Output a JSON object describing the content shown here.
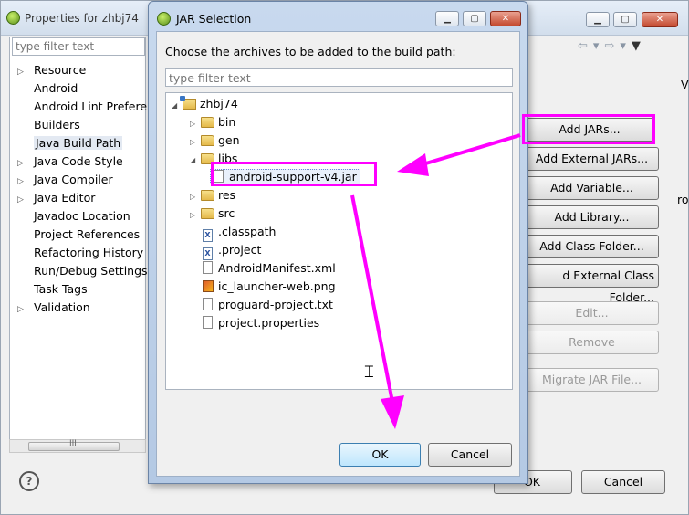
{
  "background_window": {
    "title": "Properties for zhbj74",
    "filter_placeholder": "type filter text",
    "tree_items": [
      {
        "label": "Resource",
        "expandable": true
      },
      {
        "label": "Android",
        "expandable": false
      },
      {
        "label": "Android Lint Preferences",
        "expandable": false
      },
      {
        "label": "Builders",
        "expandable": false
      },
      {
        "label": "Java Build Path",
        "expandable": false,
        "selected": true
      },
      {
        "label": "Java Code Style",
        "expandable": true
      },
      {
        "label": "Java Compiler",
        "expandable": true
      },
      {
        "label": "Java Editor",
        "expandable": true
      },
      {
        "label": "Javadoc Location",
        "expandable": false
      },
      {
        "label": "Project References",
        "expandable": false
      },
      {
        "label": "Refactoring History",
        "expandable": false
      },
      {
        "label": "Run/Debug Settings",
        "expandable": false
      },
      {
        "label": "Task Tags",
        "expandable": false
      },
      {
        "label": "Validation",
        "expandable": true
      }
    ],
    "buttons": {
      "add_jars": "Add JARs...",
      "add_external_jars": "Add External JARs...",
      "add_variable": "Add Variable...",
      "add_library": "Add Library...",
      "add_class_folder": "Add Class Folder...",
      "add_external_class_folder": "d External Class Folder...",
      "edit": "Edit...",
      "remove": "Remove",
      "migrate_jar": "Migrate JAR File...",
      "ok": "OK",
      "cancel": "Cancel"
    },
    "scroll_glyph": "III",
    "help_glyph": "?",
    "clipped_text_1": "V",
    "clipped_text_2": "ro"
  },
  "dialog": {
    "title": "JAR Selection",
    "message": "Choose the archives to be added to the build path:",
    "filter_placeholder": "type filter text",
    "tree": {
      "project": "zhbj74",
      "children": [
        {
          "label": "bin",
          "type": "folder",
          "expandable": true
        },
        {
          "label": "gen",
          "type": "folder",
          "expandable": true
        },
        {
          "label": "libs",
          "type": "folder",
          "expanded": true
        },
        {
          "label": "android-support-v4.jar",
          "type": "jar",
          "selected": true
        },
        {
          "label": "res",
          "type": "folder",
          "expandable": true
        },
        {
          "label": "src",
          "type": "folder",
          "expandable": true
        },
        {
          "label": ".classpath",
          "type": "xfile"
        },
        {
          "label": ".project",
          "type": "xfile"
        },
        {
          "label": "AndroidManifest.xml",
          "type": "file"
        },
        {
          "label": "ic_launcher-web.png",
          "type": "png"
        },
        {
          "label": "proguard-project.txt",
          "type": "file"
        },
        {
          "label": "project.properties",
          "type": "file"
        }
      ]
    },
    "ok": "OK",
    "cancel": "Cancel"
  },
  "colors": {
    "annotation": "#ff00ff",
    "titlebar": "#c8d9ee"
  }
}
